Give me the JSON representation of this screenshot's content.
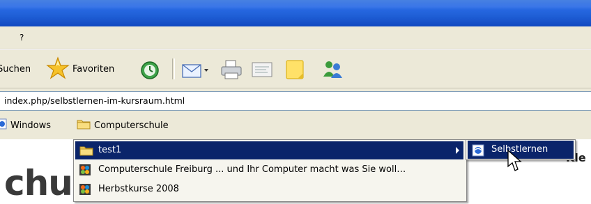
{
  "menubar": {
    "items": [
      {
        "label": "?"
      }
    ]
  },
  "toolbar": {
    "search_label": "Suchen",
    "favorites_label": "Favoriten"
  },
  "address": {
    "url": "index.php/selbstlernen-im-kursraum.html"
  },
  "links": [
    {
      "label": "Windows",
      "icon": "ie-page-icon"
    },
    {
      "label": "Computerschule",
      "icon": "folder-icon"
    }
  ],
  "folder_menu": {
    "items": [
      {
        "label": "test1",
        "icon": "folder-icon",
        "has_submenu": true,
        "selected": true
      },
      {
        "label": "Computerschule Freiburg ... und Ihr Computer macht was Sie woll…",
        "icon": "joomla-icon"
      },
      {
        "label": "Herbstkurse 2008",
        "icon": "joomla-icon"
      }
    ]
  },
  "submenu": {
    "items": [
      {
        "label": "Selbstlernen",
        "icon": "ie-page-icon",
        "selected": true
      }
    ]
  },
  "page": {
    "heading_fragment": "chu",
    "right_fragment": "Kle"
  },
  "colors": {
    "selection": "#0a246a",
    "title_bar": "#1f5fd6",
    "chrome": "#ece9d8"
  }
}
